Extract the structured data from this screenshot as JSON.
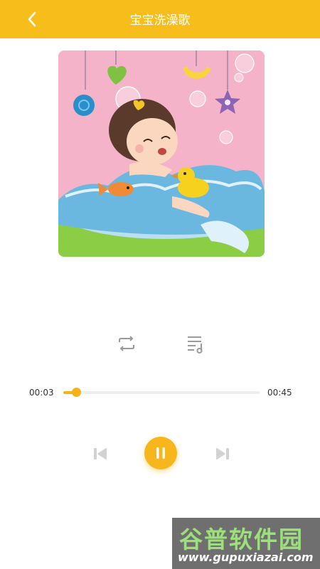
{
  "header": {
    "title": "宝宝洗澡歌",
    "back_icon": "chevron-left-icon",
    "background": "#f7bd1b"
  },
  "cover": {
    "alt": "baby bathing illustration"
  },
  "modes": {
    "repeat_icon": "repeat-icon",
    "playlist_icon": "playlist-icon"
  },
  "progress": {
    "current": "00:03",
    "total": "00:45",
    "fraction": 0.067,
    "color": "#f5b21b"
  },
  "controls": {
    "prev_icon": "previous-icon",
    "play_state_icon": "pause-icon",
    "next_icon": "next-icon"
  },
  "watermark": {
    "name": "谷普软件园",
    "url": "www.gupuxiazai.com"
  }
}
